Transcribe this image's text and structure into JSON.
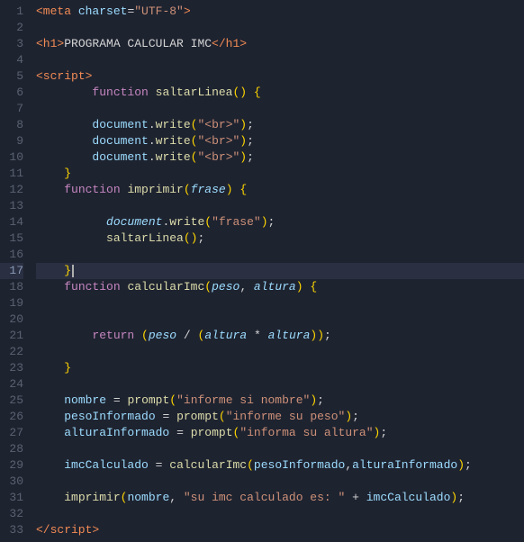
{
  "editor": {
    "lines": [
      {
        "num": 1,
        "highlighted": false
      },
      {
        "num": 2,
        "highlighted": false
      },
      {
        "num": 3,
        "highlighted": false
      },
      {
        "num": 4,
        "highlighted": false
      },
      {
        "num": 5,
        "highlighted": false
      },
      {
        "num": 6,
        "highlighted": false
      },
      {
        "num": 7,
        "highlighted": false
      },
      {
        "num": 8,
        "highlighted": false
      },
      {
        "num": 9,
        "highlighted": false
      },
      {
        "num": 10,
        "highlighted": false
      },
      {
        "num": 11,
        "highlighted": false
      },
      {
        "num": 12,
        "highlighted": false
      },
      {
        "num": 13,
        "highlighted": false
      },
      {
        "num": 14,
        "highlighted": false
      },
      {
        "num": 15,
        "highlighted": false
      },
      {
        "num": 16,
        "highlighted": false
      },
      {
        "num": 17,
        "highlighted": true
      },
      {
        "num": 18,
        "highlighted": false
      },
      {
        "num": 19,
        "highlighted": false
      },
      {
        "num": 20,
        "highlighted": false
      },
      {
        "num": 21,
        "highlighted": false
      },
      {
        "num": 22,
        "highlighted": false
      },
      {
        "num": 23,
        "highlighted": false
      },
      {
        "num": 24,
        "highlighted": false
      },
      {
        "num": 25,
        "highlighted": false
      },
      {
        "num": 26,
        "highlighted": false
      },
      {
        "num": 27,
        "highlighted": false
      },
      {
        "num": 28,
        "highlighted": false
      },
      {
        "num": 29,
        "highlighted": false
      },
      {
        "num": 30,
        "highlighted": false
      },
      {
        "num": 31,
        "highlighted": false
      },
      {
        "num": 32,
        "highlighted": false
      },
      {
        "num": 33,
        "highlighted": false
      }
    ]
  }
}
